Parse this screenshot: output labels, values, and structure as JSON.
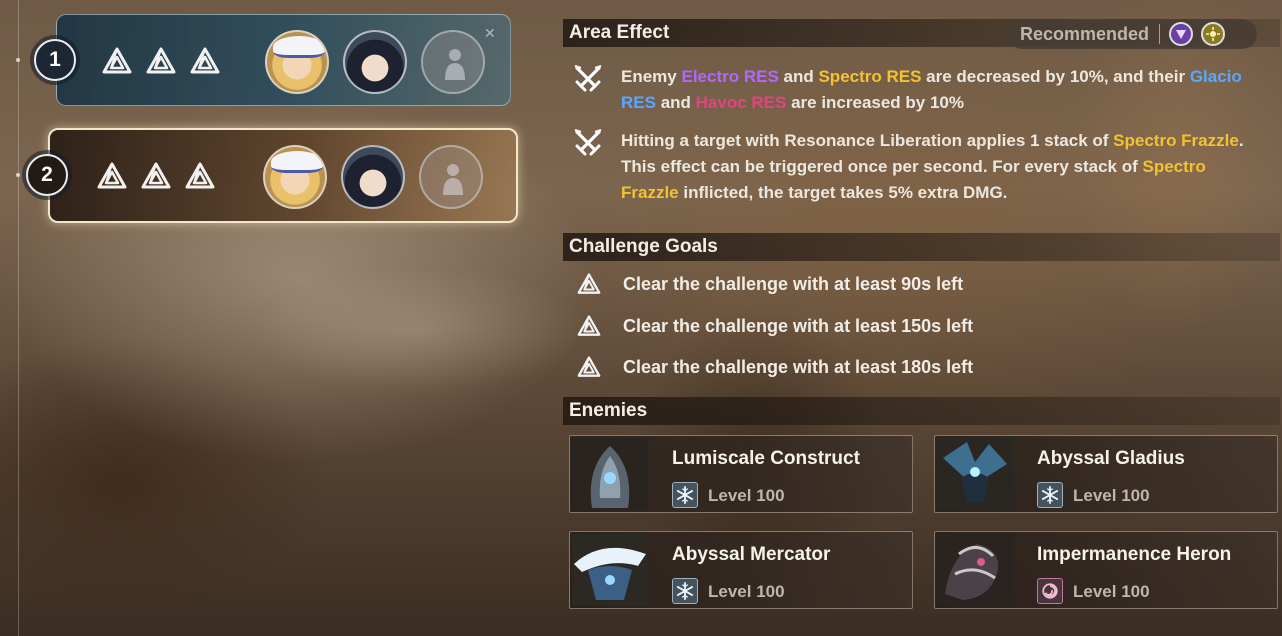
{
  "stages": [
    {
      "number": "1",
      "goal_icons": [
        "triangle-goal-icon",
        "triangle-goal-icon",
        "triangle-goal-icon"
      ],
      "team": [
        "blonde-hat-character",
        "dark-hair-character",
        "empty-slot"
      ]
    },
    {
      "number": "2",
      "goal_icons": [
        "triangle-goal-icon",
        "triangle-goal-icon",
        "triangle-goal-icon"
      ],
      "team": [
        "blonde-hat-character",
        "dark-hair-character",
        "empty-slot"
      ],
      "selected": true
    }
  ],
  "area_effect": {
    "title": "Area Effect",
    "recommended_label": "Recommended",
    "recommended_elements": [
      "electro",
      "spectro"
    ],
    "effect1": {
      "t1": "Enemy ",
      "electro": "Electro RES",
      "t2": " and ",
      "spectro": "Spectro RES",
      "t3": " are decreased by 10%, and their ",
      "glacio": "Glacio RES",
      "t4": " and ",
      "havoc": "Havoc RES",
      "t5": " are increased by 10%"
    },
    "effect2": {
      "t1": "Hitting a target with Resonance Liberation applies 1 stack of ",
      "frazzle1": "Spectro Frazzle",
      "t2": ". This effect can be triggered once per second. For every stack of ",
      "frazzle2": "Spectro Frazzle",
      "t3": " inflicted, the target takes 5% extra DMG."
    }
  },
  "challenge_goals": {
    "title": "Challenge Goals",
    "goals": [
      "Clear the challenge with at least 90s left",
      "Clear the challenge with at least 150s left",
      "Clear the challenge with at least 180s left"
    ]
  },
  "enemies": {
    "title": "Enemies",
    "list": [
      {
        "name": "Lumiscale Construct",
        "element": "glacio",
        "level": "Level 100"
      },
      {
        "name": "Abyssal Gladius",
        "element": "glacio",
        "level": "Level 100"
      },
      {
        "name": "Abyssal Mercator",
        "element": "glacio",
        "level": "Level 100"
      },
      {
        "name": "Impermanence Heron",
        "element": "havoc",
        "level": "Level 100"
      }
    ]
  },
  "colors": {
    "electro": "#b266ff",
    "spectro": "#f2c230",
    "glacio": "#5aa7ff",
    "havoc": "#e0457f"
  }
}
